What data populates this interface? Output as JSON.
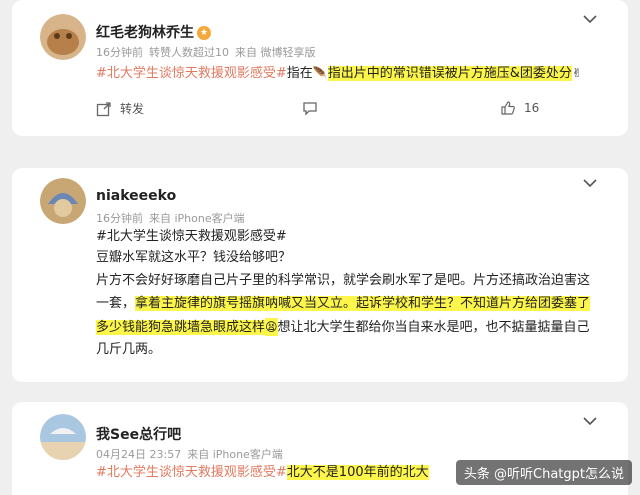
{
  "colors": {
    "accent": "#e07a5f",
    "highlight": "#fdf64a",
    "meta": "#9a9a9a",
    "background": "#efefef"
  },
  "posts": [
    {
      "user": "红毛老狗林乔生",
      "badge_icon": "vip-badge-icon",
      "meta": [
        "16分钟前",
        "转赞人数超过10",
        "来自 微博轻享版"
      ],
      "content": {
        "hashtag": "#北大学生谈惊天救援观影感受#",
        "lead": "指在",
        "mid_icon": "feather-emoji-icon",
        "highlight": "指出片中的常识错误被片方施压&团委处分",
        "end_icon": "victory-hand-emoji-icon"
      },
      "actions": {
        "share": "转发",
        "like_count": "16"
      }
    },
    {
      "user": "niakeeeko",
      "meta": [
        "16分钟前",
        "来自 iPhone客户端"
      ],
      "content": {
        "hashtag": "#北大学生谈惊天救援观影感受#",
        "line1": "豆瓣水军就这水平？钱没给够吧？",
        "line2": "片方不会好好琢磨自己片子里的科学常识，就学会刷水军了是吧。片方还搞政治迫害这",
        "line3_pre": "一套，",
        "line3_hl": "拿着主旋律的旗号摇旗呐喊又当又立。起诉学校和学生？不知道片方给团委塞了",
        "line4_hl": "多少钱能狗急跳墙急眼成这样",
        "line4_icon": "tired-face-emoji-icon",
        "line4_post": "想让北大学生都给你当自来水是吧，也不掂量掂量自己",
        "line5": "几斤几两。"
      }
    },
    {
      "user": "我See总行吧",
      "meta": [
        "04月24日 23:57",
        "来自 iPhone客户端"
      ],
      "content": {
        "hashtag": "#北大学生谈惊天救援观影感受#",
        "highlight": "北大不是100年前的北大"
      }
    }
  ],
  "watermark": "头条 @听听Chatgpt怎么说"
}
